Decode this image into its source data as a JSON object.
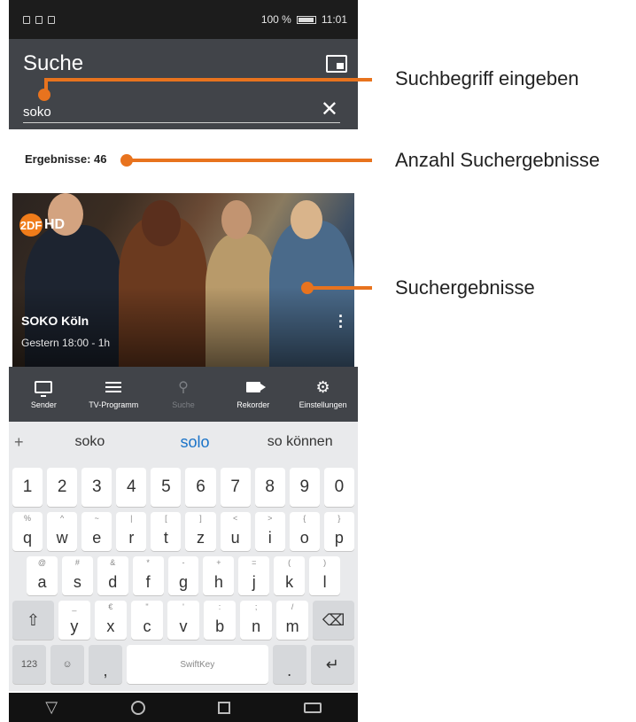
{
  "status_bar": {
    "battery": "100 %",
    "time": "11:01"
  },
  "app_bar": {
    "title": "Suche",
    "search_value": "soko"
  },
  "results": {
    "count_label": "Ergebnisse: 46"
  },
  "result_card": {
    "channel_badge": "2DF",
    "channel_suffix": "HD",
    "title": "SOKO Köln",
    "time": "Gestern 18:00 - 1h"
  },
  "bottom_nav": [
    {
      "label": "Sender",
      "icon": "tv-icon"
    },
    {
      "label": "TV-Programm",
      "icon": "list-icon"
    },
    {
      "label": "Suche",
      "icon": "search-icon"
    },
    {
      "label": "Rekorder",
      "icon": "camera-icon"
    },
    {
      "label": "Einstellungen",
      "icon": "gear-icon"
    }
  ],
  "keyboard": {
    "suggestions": [
      "soko",
      "solo",
      "so können"
    ],
    "numbers": [
      "1",
      "2",
      "3",
      "4",
      "5",
      "6",
      "7",
      "8",
      "9",
      "0"
    ],
    "row1": [
      [
        "%",
        "q"
      ],
      [
        "^",
        "w"
      ],
      [
        "~",
        "e"
      ],
      [
        "|",
        "r"
      ],
      [
        "[",
        "t"
      ],
      [
        "]",
        "z"
      ],
      [
        "<",
        "u"
      ],
      [
        ">",
        "i"
      ],
      [
        "{",
        "o"
      ],
      [
        "}",
        "p"
      ]
    ],
    "row2": [
      [
        "@",
        "a"
      ],
      [
        "#",
        "s"
      ],
      [
        "&",
        "d"
      ],
      [
        "*",
        "f"
      ],
      [
        "-",
        "g"
      ],
      [
        "+",
        "h"
      ],
      [
        "=",
        "j"
      ],
      [
        "(",
        "k"
      ],
      [
        ")",
        "l"
      ]
    ],
    "row3": [
      [
        "_",
        "y"
      ],
      [
        "€",
        "x"
      ],
      [
        "\"",
        "c"
      ],
      [
        "'",
        "v"
      ],
      [
        ":",
        "b"
      ],
      [
        ";",
        "n"
      ],
      [
        "/",
        "m"
      ]
    ],
    "bottom_left": "123",
    "space_label": "SwiftKey",
    "comma": ",",
    "period": "."
  },
  "annotations": {
    "search": "Suchbegriff eingeben",
    "count": "Anzahl Suchergebnisse",
    "results": "Suchergebnisse"
  },
  "colors": {
    "appbar": "#414449",
    "accent": "#e8731e",
    "suggestion": "#1a73c8"
  }
}
